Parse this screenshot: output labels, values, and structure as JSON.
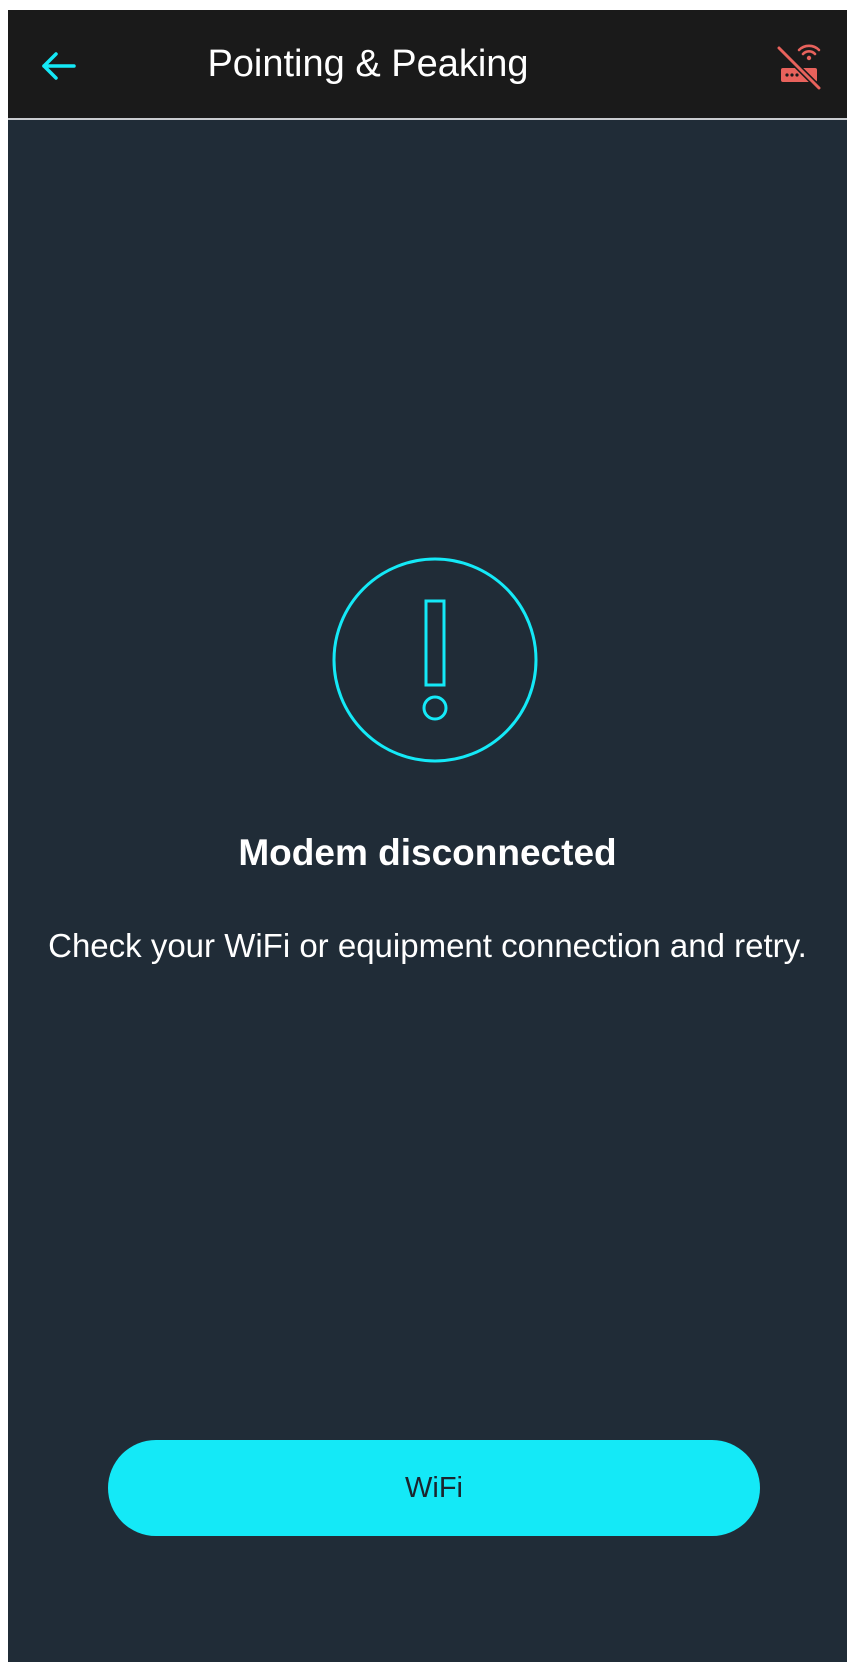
{
  "header": {
    "title": "Pointing & Peaking",
    "back_icon": "arrow-left-icon",
    "status_icon": "router-wifi-off-icon"
  },
  "status": {
    "icon": "alert-circle-icon",
    "heading": "Modem disconnected",
    "message": "Check your WiFi or equipment connection and retry."
  },
  "actions": {
    "wifi_label": "WiFi"
  },
  "colors": {
    "accent": "#14e9f7",
    "background": "#202c37",
    "app_bar": "#1a1a1a",
    "error": "#e8625c",
    "text": "#ffffff"
  }
}
